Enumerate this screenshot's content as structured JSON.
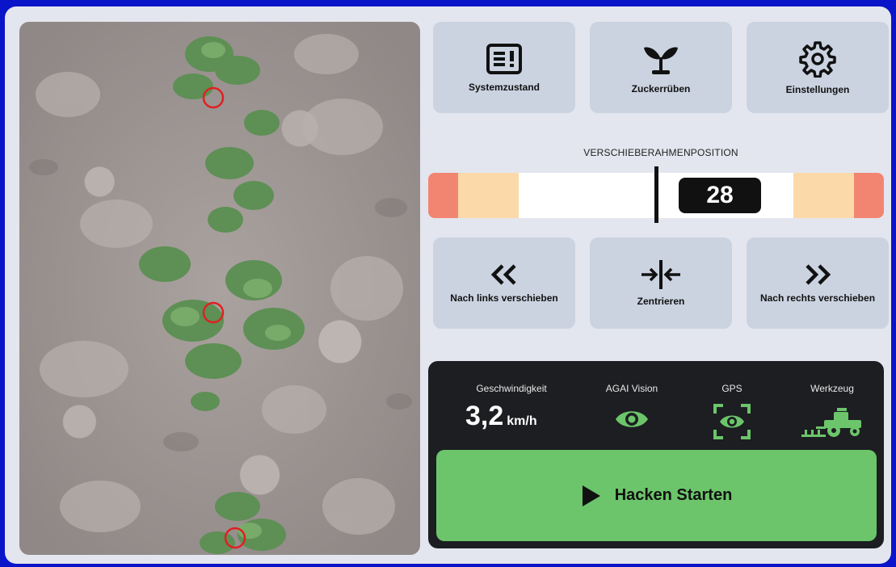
{
  "top_buttons": [
    {
      "label": "Systemzustand",
      "icon": "status-board-icon"
    },
    {
      "label": "Zuckerrüben",
      "icon": "sprout-icon"
    },
    {
      "label": "Einstellungen",
      "icon": "gear-icon"
    }
  ],
  "slider": {
    "title": "VERSCHIEBERAHMENPOSITION",
    "value": "28",
    "colors": {
      "red": "#f28572",
      "orange": "#fbd9a8",
      "white": "#ffffff"
    }
  },
  "shift_buttons": [
    {
      "label": "Nach links verschieben",
      "icon": "double-chevron-left-icon"
    },
    {
      "label": "Zentrieren",
      "icon": "center-arrows-icon"
    },
    {
      "label": "Nach rechts verschieben",
      "icon": "double-chevron-right-icon"
    }
  ],
  "status": {
    "speed_label": "Geschwindigkeit",
    "speed_value": "3,2",
    "speed_unit": "km/h",
    "vision_label": "AGAI Vision",
    "gps_label": "GPS",
    "tool_label": "Werkzeug",
    "accent": "#6cc56b"
  },
  "start_button": {
    "label": "Hacken Starten",
    "icon": "play-icon"
  }
}
